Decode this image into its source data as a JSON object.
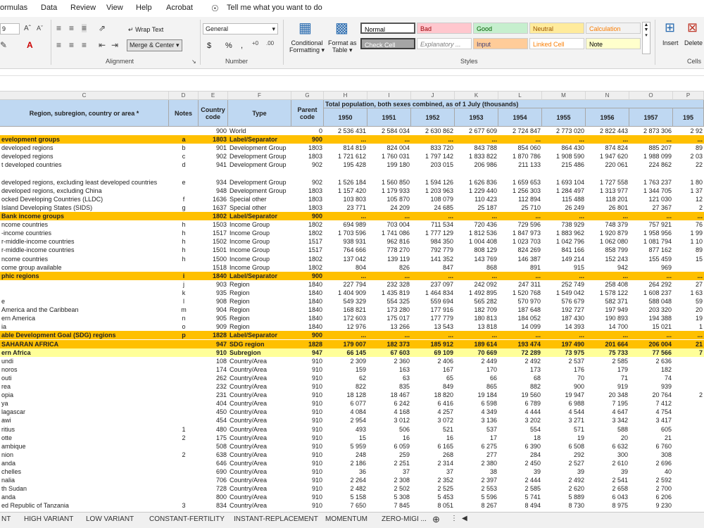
{
  "menu": [
    "ormulas",
    "Data",
    "Review",
    "View",
    "Help",
    "Acrobat"
  ],
  "tellme": "Tell me what you want to do",
  "ribbon": {
    "font_size": "9",
    "wrap_text": "Wrap Text",
    "merge_center": "Merge & Center",
    "number_format": "General",
    "currency": "$",
    "percent": "%",
    "comma": ",",
    "cond_format": [
      "Conditional",
      "Formatting"
    ],
    "format_table": [
      "Format as",
      "Table"
    ],
    "styles": [
      {
        "label": "Normal",
        "bg": "#ffffff",
        "fg": "#000000"
      },
      {
        "label": "Bad",
        "bg": "#ffc7ce",
        "fg": "#9c0006"
      },
      {
        "label": "Good",
        "bg": "#c6efce",
        "fg": "#006100"
      },
      {
        "label": "Neutral",
        "bg": "#ffeb9c",
        "fg": "#9c5700"
      },
      {
        "label": "Calculation",
        "bg": "#f2f2f2",
        "fg": "#fa7d00"
      },
      {
        "label": "Check Cell",
        "bg": "#a5a5a5",
        "fg": "#ffffff"
      },
      {
        "label": "Explanatory ...",
        "bg": "#ffffff",
        "fg": "#7f7f7f"
      },
      {
        "label": "Input",
        "bg": "#ffcc99",
        "fg": "#3f3f76"
      },
      {
        "label": "Linked Cell",
        "bg": "#ffffff",
        "fg": "#fa7d00"
      },
      {
        "label": "Note",
        "bg": "#ffffcc",
        "fg": "#000000"
      }
    ],
    "insert": "Insert",
    "delete": "Delete",
    "groups": [
      "Alignment",
      "Number",
      "Styles",
      "Cells"
    ]
  },
  "columns": [
    "C",
    "D",
    "E",
    "F",
    "G",
    "H",
    "I",
    "J",
    "K",
    "L",
    "M",
    "N",
    "O",
    "P"
  ],
  "header": {
    "region": "Region, subregion, country or area *",
    "notes": "Notes",
    "country_code": "Country code",
    "type": "Type",
    "parent_code": "Parent code",
    "span": "Total population, both sexes combined, as of 1 July (thousands)",
    "years": [
      "1950",
      "1951",
      "1952",
      "1953",
      "1954",
      "1955",
      "1956",
      "1957",
      "195"
    ]
  },
  "rows": [
    {
      "name": "",
      "note": "",
      "code": "900",
      "type": "World",
      "parent": "0",
      "v": [
        "2 536 431",
        "2 584 034",
        "2 630 862",
        "2 677 609",
        "2 724 847",
        "2 773 020",
        "2 822 443",
        "2 873 306",
        "2 92"
      ]
    },
    {
      "name": "evelopment groups",
      "note": "a",
      "code": "1803",
      "type": "Label/Separator",
      "parent": "900",
      "v": [
        "...",
        "...",
        "...",
        "...",
        "...",
        "...",
        "...",
        "...",
        "..."
      ],
      "style": "band"
    },
    {
      "name": "developed regions",
      "note": "b",
      "code": "901",
      "type": "Development Group",
      "parent": "1803",
      "v": [
        "814 819",
        "824 004",
        "833 720",
        "843 788",
        "854 060",
        "864 430",
        "874 824",
        "885 207",
        "89"
      ]
    },
    {
      "name": "developed regions",
      "note": "c",
      "code": "902",
      "type": "Development Group",
      "parent": "1803",
      "v": [
        "1 721 612",
        "1 760 031",
        "1 797 142",
        "1 833 822",
        "1 870 786",
        "1 908 590",
        "1 947 620",
        "1 988 099",
        "2 03"
      ]
    },
    {
      "name": "t developed countries",
      "note": "d",
      "code": "941",
      "type": "Development Group",
      "parent": "902",
      "v": [
        "195 428",
        "199 180",
        "203 015",
        "206 986",
        "211 133",
        "215 486",
        "220 061",
        "224 862",
        "22"
      ]
    },
    {
      "name": "",
      "note": "",
      "code": "",
      "type": "",
      "parent": "",
      "v": [
        "",
        "",
        "",
        "",
        "",
        "",
        "",
        "",
        ""
      ]
    },
    {
      "name": "developed regions, excluding least developed countries",
      "note": "e",
      "code": "934",
      "type": "Development Group",
      "parent": "902",
      "v": [
        "1 526 184",
        "1 560 850",
        "1 594 126",
        "1 626 836",
        "1 659 653",
        "1 693 104",
        "1 727 558",
        "1 763 237",
        "1 80"
      ]
    },
    {
      "name": "developed regions, excluding China",
      "note": "",
      "code": "948",
      "type": "Development Group",
      "parent": "1803",
      "v": [
        "1 157 420",
        "1 179 933",
        "1 203 963",
        "1 229 440",
        "1 256 303",
        "1 284 497",
        "1 313 977",
        "1 344 705",
        "1 37"
      ]
    },
    {
      "name": "ocked Developing Countries (LLDC)",
      "note": "f",
      "code": "1636",
      "type": "Special other",
      "parent": "1803",
      "v": [
        "103 803",
        "105 870",
        "108 079",
        "110 423",
        "112 894",
        "115 488",
        "118 201",
        "121 030",
        "12"
      ]
    },
    {
      "name": "Island Developing States (SIDS)",
      "note": "g",
      "code": "1637",
      "type": "Special other",
      "parent": "1803",
      "v": [
        "23 771",
        "24 209",
        "24 685",
        "25 187",
        "25 710",
        "26 249",
        "26 801",
        "27 367",
        "2"
      ]
    },
    {
      "name": "Bank income groups",
      "note": "",
      "code": "1802",
      "type": "Label/Separator",
      "parent": "900",
      "v": [
        "...",
        "...",
        "...",
        "...",
        "...",
        "...",
        "...",
        "...",
        "..."
      ],
      "style": "band"
    },
    {
      "name": "ncome countries",
      "note": "h",
      "code": "1503",
      "type": "Income Group",
      "parent": "1802",
      "v": [
        "694 989",
        "703 004",
        "711 534",
        "720 436",
        "729 596",
        "738 929",
        "748 379",
        "757 921",
        "76"
      ]
    },
    {
      "name": "-income countries",
      "note": "h",
      "code": "1517",
      "type": "Income Group",
      "parent": "1802",
      "v": [
        "1 703 596",
        "1 741 086",
        "1 777 129",
        "1 812 536",
        "1 847 973",
        "1 883 962",
        "1 920 879",
        "1 958 956",
        "1 99"
      ]
    },
    {
      "name": "r-middle-income countries",
      "note": "h",
      "code": "1502",
      "type": "Income Group",
      "parent": "1517",
      "v": [
        "938 931",
        "962 816",
        "984 350",
        "1 004 408",
        "1 023 703",
        "1 042 796",
        "1 062 080",
        "1 081 794",
        "1 10"
      ]
    },
    {
      "name": "r-middle-income countries",
      "note": "h",
      "code": "1501",
      "type": "Income Group",
      "parent": "1517",
      "v": [
        "764 666",
        "778 270",
        "792 779",
        "808 129",
        "824 269",
        "841 166",
        "858 799",
        "877 162",
        "89"
      ]
    },
    {
      "name": "ncome countries",
      "note": "h",
      "code": "1500",
      "type": "Income Group",
      "parent": "1802",
      "v": [
        "137 042",
        "139 119",
        "141 352",
        "143 769",
        "146 387",
        "149 214",
        "152 243",
        "155 459",
        "15"
      ]
    },
    {
      "name": "come group available",
      "note": "",
      "code": "1518",
      "type": "Income Group",
      "parent": "1802",
      "v": [
        "804",
        "826",
        "847",
        "868",
        "891",
        "915",
        "942",
        "969",
        ""
      ]
    },
    {
      "name": "phic regions",
      "note": "i",
      "code": "1840",
      "type": "Label/Separator",
      "parent": "900",
      "v": [
        "...",
        "...",
        "...",
        "...",
        "...",
        "...",
        "...",
        "...",
        "..."
      ],
      "style": "band"
    },
    {
      "name": "",
      "note": "j",
      "code": "903",
      "type": "Region",
      "parent": "1840",
      "v": [
        "227 794",
        "232 328",
        "237 097",
        "242 092",
        "247 311",
        "252 749",
        "258 408",
        "264 292",
        "27"
      ]
    },
    {
      "name": "",
      "note": "k",
      "code": "935",
      "type": "Region",
      "parent": "1840",
      "v": [
        "1 404 909",
        "1 435 819",
        "1 464 834",
        "1 492 895",
        "1 520 768",
        "1 549 042",
        "1 578 122",
        "1 608 237",
        "1 63"
      ]
    },
    {
      "name": "e",
      "note": "l",
      "code": "908",
      "type": "Region",
      "parent": "1840",
      "v": [
        "549 329",
        "554 325",
        "559 694",
        "565 282",
        "570 970",
        "576 679",
        "582 371",
        "588 048",
        "59"
      ]
    },
    {
      "name": "America and the Caribbean",
      "note": "m",
      "code": "904",
      "type": "Region",
      "parent": "1840",
      "v": [
        "168 821",
        "173 280",
        "177 916",
        "182 709",
        "187 648",
        "192 727",
        "197 949",
        "203 320",
        "20"
      ]
    },
    {
      "name": "ern America",
      "note": "n",
      "code": "905",
      "type": "Region",
      "parent": "1840",
      "v": [
        "172 603",
        "175 017",
        "177 779",
        "180 813",
        "184 052",
        "187 430",
        "190 893",
        "194 388",
        "19"
      ]
    },
    {
      "name": "ia",
      "note": "o",
      "code": "909",
      "type": "Region",
      "parent": "1840",
      "v": [
        "12 976",
        "13 266",
        "13 543",
        "13 818",
        "14 099",
        "14 393",
        "14 700",
        "15 021",
        "1"
      ]
    },
    {
      "name": "able Development Goal (SDG) regions",
      "note": "p",
      "code": "1828",
      "type": "Label/Separator",
      "parent": "900",
      "v": [
        "...",
        "...",
        "...",
        "...",
        "...",
        "...",
        "...",
        "...",
        "..."
      ],
      "style": "band"
    },
    {
      "name": "SAHARAN AFRICA",
      "note": "",
      "code": "947",
      "type": "SDG region",
      "parent": "1828",
      "v": [
        "179 007",
        "182 373",
        "185 912",
        "189 614",
        "193 474",
        "197 490",
        "201 664",
        "206 004",
        "21"
      ],
      "style": "sdg"
    },
    {
      "name": "ern Africa",
      "note": "",
      "code": "910",
      "type": "Subregion",
      "parent": "947",
      "v": [
        "66 145",
        "67 603",
        "69 109",
        "70 669",
        "72 289",
        "73 975",
        "75 733",
        "77 566",
        "7"
      ],
      "style": "sub"
    },
    {
      "name": "undi",
      "note": "",
      "code": "108",
      "type": "Country/Area",
      "parent": "910",
      "v": [
        "2 309",
        "2 360",
        "2 406",
        "2 449",
        "2 492",
        "2 537",
        "2 585",
        "2 636",
        ""
      ]
    },
    {
      "name": "noros",
      "note": "",
      "code": "174",
      "type": "Country/Area",
      "parent": "910",
      "v": [
        "159",
        "163",
        "167",
        "170",
        "173",
        "176",
        "179",
        "182",
        ""
      ]
    },
    {
      "name": "outi",
      "note": "",
      "code": "262",
      "type": "Country/Area",
      "parent": "910",
      "v": [
        "62",
        "63",
        "65",
        "66",
        "68",
        "70",
        "71",
        "74",
        ""
      ]
    },
    {
      "name": "rea",
      "note": "",
      "code": "232",
      "type": "Country/Area",
      "parent": "910",
      "v": [
        "822",
        "835",
        "849",
        "865",
        "882",
        "900",
        "919",
        "939",
        ""
      ]
    },
    {
      "name": "opia",
      "note": "",
      "code": "231",
      "type": "Country/Area",
      "parent": "910",
      "v": [
        "18 128",
        "18 467",
        "18 820",
        "19 184",
        "19 560",
        "19 947",
        "20 348",
        "20 764",
        "2"
      ]
    },
    {
      "name": "ya",
      "note": "",
      "code": "404",
      "type": "Country/Area",
      "parent": "910",
      "v": [
        "6 077",
        "6 242",
        "6 416",
        "6 598",
        "6 789",
        "6 988",
        "7 195",
        "7 412",
        ""
      ]
    },
    {
      "name": "lagascar",
      "note": "",
      "code": "450",
      "type": "Country/Area",
      "parent": "910",
      "v": [
        "4 084",
        "4 168",
        "4 257",
        "4 349",
        "4 444",
        "4 544",
        "4 647",
        "4 754",
        ""
      ]
    },
    {
      "name": "awi",
      "note": "",
      "code": "454",
      "type": "Country/Area",
      "parent": "910",
      "v": [
        "2 954",
        "3 012",
        "3 072",
        "3 136",
        "3 202",
        "3 271",
        "3 342",
        "3 417",
        ""
      ]
    },
    {
      "name": "ritius",
      "note": "1",
      "code": "480",
      "type": "Country/Area",
      "parent": "910",
      "v": [
        "493",
        "506",
        "521",
        "537",
        "554",
        "571",
        "588",
        "605",
        ""
      ]
    },
    {
      "name": "otte",
      "note": "2",
      "code": "175",
      "type": "Country/Area",
      "parent": "910",
      "v": [
        "15",
        "16",
        "16",
        "17",
        "18",
        "19",
        "20",
        "21",
        ""
      ]
    },
    {
      "name": "ambique",
      "note": "",
      "code": "508",
      "type": "Country/Area",
      "parent": "910",
      "v": [
        "5 959",
        "6 059",
        "6 165",
        "6 275",
        "6 390",
        "6 508",
        "6 632",
        "6 760",
        ""
      ]
    },
    {
      "name": "nion",
      "note": "2",
      "code": "638",
      "type": "Country/Area",
      "parent": "910",
      "v": [
        "248",
        "259",
        "268",
        "277",
        "284",
        "292",
        "300",
        "308",
        ""
      ]
    },
    {
      "name": "anda",
      "note": "",
      "code": "646",
      "type": "Country/Area",
      "parent": "910",
      "v": [
        "2 186",
        "2 251",
        "2 314",
        "2 380",
        "2 450",
        "2 527",
        "2 610",
        "2 696",
        ""
      ]
    },
    {
      "name": "chelles",
      "note": "",
      "code": "690",
      "type": "Country/Area",
      "parent": "910",
      "v": [
        "36",
        "37",
        "37",
        "38",
        "39",
        "39",
        "39",
        "40",
        ""
      ]
    },
    {
      "name": "nalia",
      "note": "",
      "code": "706",
      "type": "Country/Area",
      "parent": "910",
      "v": [
        "2 264",
        "2 308",
        "2 352",
        "2 397",
        "2 444",
        "2 492",
        "2 541",
        "2 592",
        ""
      ]
    },
    {
      "name": "th Sudan",
      "note": "",
      "code": "728",
      "type": "Country/Area",
      "parent": "910",
      "v": [
        "2 482",
        "2 502",
        "2 525",
        "2 553",
        "2 585",
        "2 620",
        "2 658",
        "2 700",
        ""
      ]
    },
    {
      "name": "anda",
      "note": "",
      "code": "800",
      "type": "Country/Area",
      "parent": "910",
      "v": [
        "5 158",
        "5 308",
        "5 453",
        "5 596",
        "5 741",
        "5 889",
        "6 043",
        "6 206",
        ""
      ]
    },
    {
      "name": "ed Republic of Tanzania",
      "note": "3",
      "code": "834",
      "type": "Country/Area",
      "parent": "910",
      "v": [
        "7 650",
        "7 845",
        "8 051",
        "8 267",
        "8 494",
        "8 730",
        "8 975",
        "9 230",
        ""
      ]
    }
  ],
  "tabs": [
    "NT",
    "HIGH VARIANT",
    "LOW VARIANT",
    "CONSTANT-FERTILITY",
    "INSTANT-REPLACEMENT",
    "MOMENTUM",
    "ZERO-MIGI ..."
  ],
  "colors": {
    "header": "#bfd8f2",
    "band": "#ffc000",
    "sdg": "#ffc000",
    "sub": "#ffff99"
  }
}
